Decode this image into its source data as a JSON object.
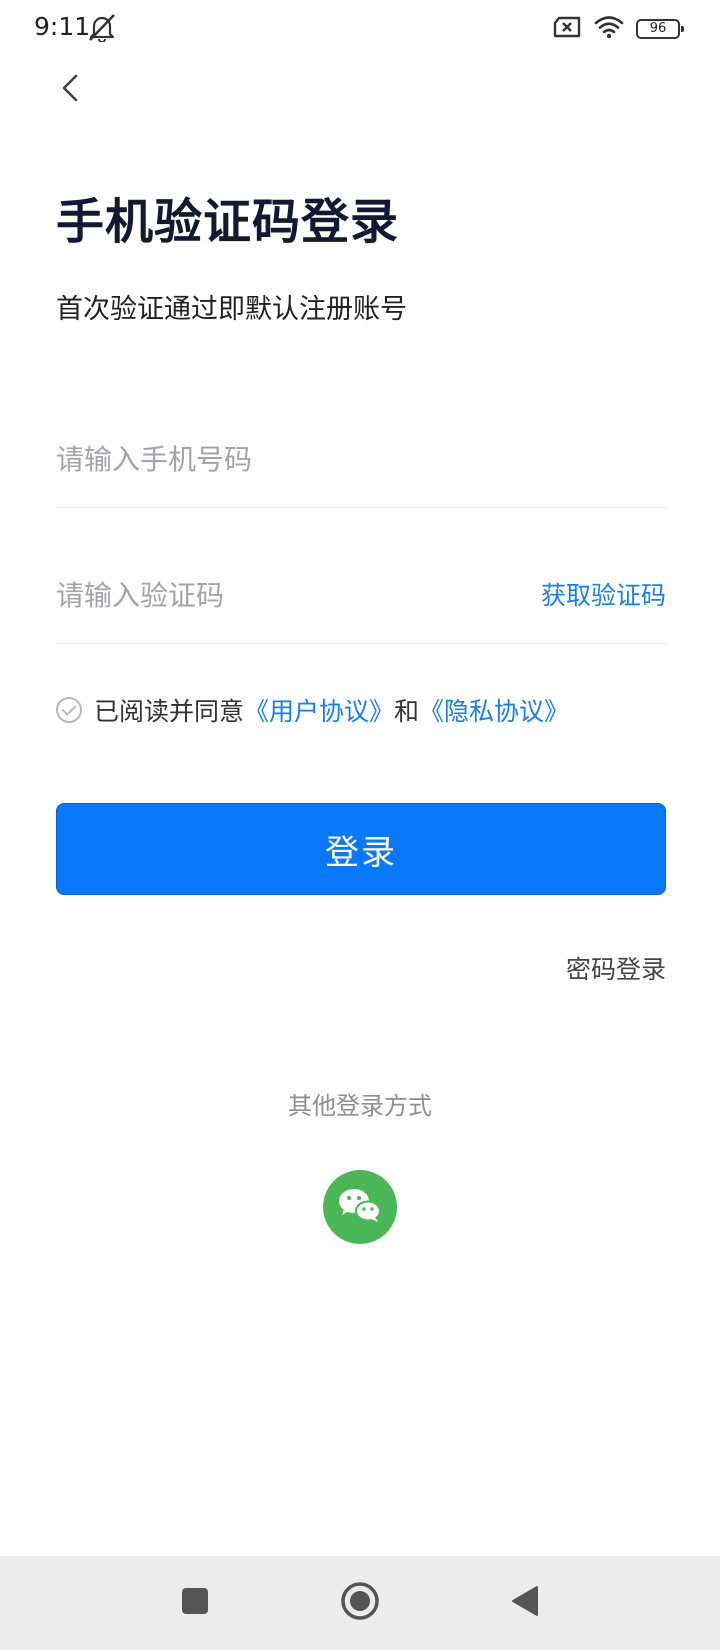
{
  "status_bar": {
    "time": "9:11",
    "battery_level": "96",
    "icons": [
      "bell-off-icon",
      "sim-none-icon",
      "wifi-icon",
      "battery-icon"
    ]
  },
  "header": {
    "back_icon": "chevron-left-icon"
  },
  "page": {
    "title": "手机验证码登录",
    "subtitle": "首次验证通过即默认注册账号"
  },
  "form": {
    "phone_placeholder": "请输入手机号码",
    "phone_value": "",
    "code_placeholder": "请输入验证码",
    "code_value": "",
    "get_code_label": "获取验证码"
  },
  "agreement": {
    "prefix": "已阅读并同意",
    "user_agreement": "《用户协议》",
    "connector": "和",
    "privacy_policy": "《隐私协议》",
    "checked": false
  },
  "actions": {
    "login_label": "登录",
    "password_login_label": "密码登录"
  },
  "other_login": {
    "label": "其他登录方式",
    "wechat_icon": "wechat-icon"
  },
  "nav_bar": {
    "icons": [
      "recent-apps-icon",
      "home-icon",
      "back-triangle-icon"
    ]
  },
  "colors": {
    "primary": "#0a78fb",
    "link": "#1b7fe6",
    "title": "#141830",
    "wechat": "#4cb758",
    "nav_background": "#ececec"
  }
}
